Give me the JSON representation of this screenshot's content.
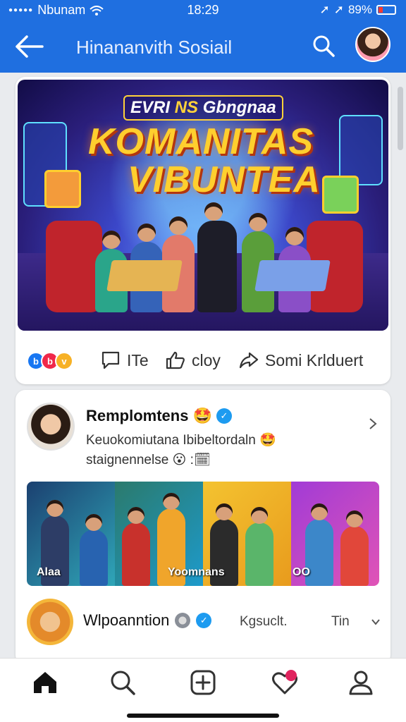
{
  "status": {
    "carrier": "Nbunam",
    "time": "18:29",
    "battery": "89%"
  },
  "header": {
    "title": "Hinananvith Sosiail"
  },
  "banner": {
    "tagline_a": "EVRI",
    "tagline_b": "NS",
    "tagline_c": "Gbngnaa",
    "title_line1": "KOMANITAS",
    "title_line2": "VIBUNTEA"
  },
  "actions": {
    "comment": "ITe",
    "like": "cloy",
    "share": "Somi Krlduert"
  },
  "reaction_icons": [
    "b",
    "b",
    "v"
  ],
  "colors": {
    "header_bg": "#1f6fe0",
    "accent": "#1d9bf0",
    "banner_title": "#ffcf2e"
  },
  "post1": {
    "username": "Remplomtens",
    "text_line1": "Keuokomiutana Ibibeltordaln 🤩",
    "text_line2": "staignennelse 😮 :🗓",
    "strip_label_left": "Alaa",
    "strip_label_mid": "Yoomnans",
    "strip_label_right": "OO"
  },
  "post2": {
    "username": "Wlpoanntion",
    "meta1": "Kgsuclt.",
    "meta2": "Tin"
  },
  "nav": {
    "items": [
      "home-icon",
      "search-icon",
      "add-icon",
      "heart-icon",
      "profile-icon"
    ]
  }
}
